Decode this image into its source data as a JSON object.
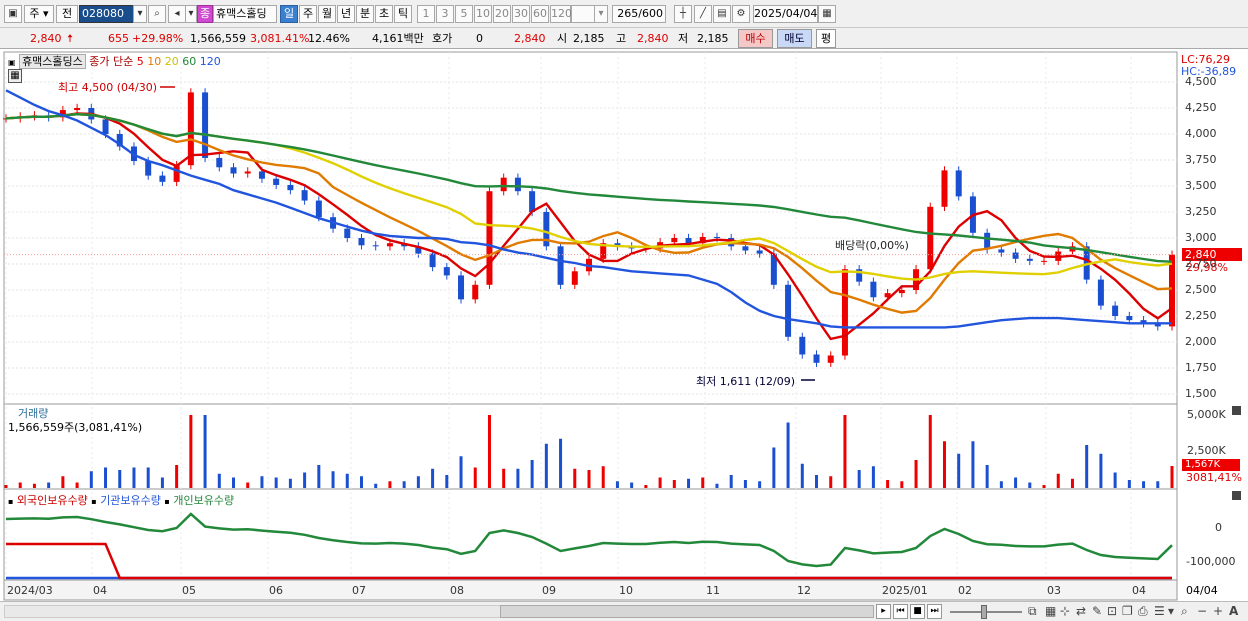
{
  "toolbar": {
    "win_label": "주",
    "prev_label": "전",
    "code": "028080",
    "stock_name": "휴맥스홀딩",
    "stock_badge": "종",
    "period_day": "일",
    "period_week": "주",
    "period_month": "월",
    "period_year": "년",
    "period_minute": "분",
    "period_second": "초",
    "period_tick": "틱",
    "intervals": [
      "1",
      "3",
      "5",
      "10",
      "20",
      "30",
      "60",
      "120"
    ],
    "count": "265",
    "count_max": "/600",
    "date": "2025/04/04"
  },
  "quote": {
    "price": "2,840",
    "change": "655",
    "change_pct": "+29.98%",
    "volume": "1,566,559",
    "volume_pct": "3,081.41%",
    "turnover_rate": "12.46%",
    "trade_value": "4,161백만",
    "bid_label": "호가",
    "bid_value": "0",
    "ask_price": "2,840",
    "open_label": "시",
    "open": "2,185",
    "high_label": "고",
    "high": "2,840",
    "low_label": "저",
    "low": "2,185",
    "buy_label": "매수",
    "sell_label": "매도",
    "avg_label": "평"
  },
  "price_panel": {
    "name_tag": "휴맥스홀딩스",
    "legend_head": "종가 단순",
    "ma_labels": [
      "5",
      "10",
      "20",
      "60",
      "120"
    ],
    "ma_colors": [
      "#dd0000",
      "#e07b00",
      "#e0d000",
      "#22883a",
      "#2255dd"
    ],
    "high_note": "최고 4,500 (04/30)",
    "low_note": "최저 1,611 (12/09)",
    "div_note": "배당락(0,00%)",
    "lc": "LC:76,29",
    "hc": "HC:-36,89",
    "current_price": "2,840",
    "current_pct": "29,98%",
    "y_ticks": [
      "4,500",
      "4,250",
      "4,000",
      "3,750",
      "3,500",
      "3,250",
      "3,000",
      "2,750",
      "2,500",
      "2,250",
      "2,000",
      "1,750",
      "1,500"
    ]
  },
  "volume_panel": {
    "title": "거래량",
    "value": "1,566,559주(3,081,41%)",
    "y_ticks": [
      "5,000K",
      "2,500K"
    ],
    "current": "1,567K",
    "current_pct": "3081,41%"
  },
  "holdings_panel": {
    "legend": [
      "외국인보유수량",
      "기관보유수량",
      "개인보유수량"
    ],
    "legend_colors": [
      "#dd0000",
      "#2255dd",
      "#22883a"
    ],
    "y_ticks": [
      "0",
      "-100,000"
    ]
  },
  "x_axis": {
    "labels": [
      "2024/03",
      "04",
      "05",
      "06",
      "07",
      "08",
      "09",
      "10",
      "11",
      "12",
      "2025/01",
      "02",
      "03",
      "04"
    ],
    "last": "04/04"
  },
  "chart_data": {
    "type": "candlestick",
    "series": [
      {
        "name": "종가",
        "values": [
          4150,
          4170,
          4180,
          4160,
          4230,
          4250,
          4140,
          4000,
          3880,
          3740,
          3600,
          3540,
          3700,
          4400,
          3770,
          3680,
          3620,
          3640,
          3570,
          3510,
          3460,
          3360,
          3200,
          3090,
          3000,
          2930,
          2920,
          2950,
          2920,
          2850,
          2720,
          2640,
          2410,
          2550,
          3450,
          3580,
          3450,
          3250,
          2920,
          2550,
          2680,
          2800,
          2950,
          2920,
          2900,
          2900,
          2960,
          3000,
          2950,
          3010,
          3000,
          2920,
          2880,
          2850,
          2550,
          2050,
          1880,
          1800,
          1870,
          2700,
          2580,
          2430,
          2470,
          2500,
          2700,
          3300,
          3650,
          3400,
          3050,
          2890,
          2860,
          2800,
          2780,
          2780,
          2870,
          2920,
          2600,
          2350,
          2250,
          2210,
          2180,
          2150,
          2840
        ]
      },
      {
        "name": "120",
        "values": [
          4420,
          4350,
          4280,
          4220,
          4180,
          4130,
          4060,
          3990,
          3900,
          3800,
          3740,
          3700,
          3650,
          3600,
          3560,
          3520,
          3460,
          3420,
          3380,
          3340,
          3290,
          3240,
          3190,
          3150,
          3110,
          3070,
          3040,
          3020,
          3010,
          3000,
          3000,
          2990,
          2960,
          2950,
          2930,
          2890,
          2860,
          2840,
          2810,
          2780,
          2760,
          2730,
          2720,
          2700,
          2680,
          2670,
          2660,
          2650,
          2640,
          2600,
          2560,
          2480,
          2380,
          2300,
          2250,
          2220,
          2200,
          2180,
          2150,
          2140,
          2140,
          2140,
          2140,
          2140,
          2140,
          2140,
          2140,
          2150,
          2170,
          2190,
          2210,
          2220,
          2230,
          2230,
          2230,
          2220,
          2210,
          2200,
          2190,
          2180,
          2180,
          2180,
          2180
        ]
      }
    ],
    "volume_series": {
      "name": "거래량",
      "unit": "주"
    },
    "y_range": [
      1500,
      4500
    ],
    "volume_range": [
      0,
      5000000
    ],
    "holdings_range": [
      -100000,
      0
    ]
  }
}
